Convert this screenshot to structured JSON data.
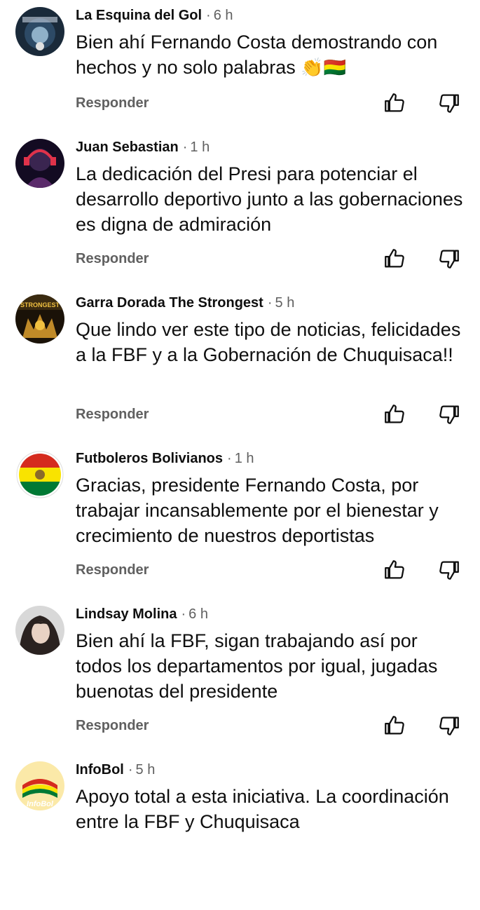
{
  "reply_label": "Responder",
  "separator": "·",
  "comments": [
    {
      "author": "La Esquina del Gol",
      "time": "6 h",
      "text": "Bien ahí Fernando Costa demostrando con hechos y no solo palabras",
      "emoji": "👏🇧🇴",
      "avatar": "la-esquina-del-gol-avatar"
    },
    {
      "author": "Juan Sebastian",
      "time": "1 h",
      "text": "La dedicación del Presi para potenciar el desarrollo deportivo junto a las gobernaciones es digna de admiración",
      "avatar": "juan-sebastian-avatar"
    },
    {
      "author": "Garra Dorada The Strongest",
      "time": "5 h",
      "text": "Que lindo ver este tipo de noticias, felicidades a la FBF y a la Gobernación de Chuquisaca!!",
      "avatar": "garra-dorada-avatar"
    },
    {
      "author": "Futboleros Bolivianos",
      "time": "1 h",
      "text": "Gracias, presidente Fernando Costa, por trabajar incansablemente por el bienestar y crecimiento de nuestros deportistas",
      "avatar": "futboleros-bolivianos-avatar"
    },
    {
      "author": "Lindsay Molina",
      "time": "6 h",
      "text": "Bien ahí la FBF, sigan trabajando así por todos los departamentos por igual, jugadas buenotas del presidente",
      "avatar": "lindsay-molina-avatar"
    },
    {
      "author": "InfoBol",
      "time": "5 h",
      "text": "Apoyo total a esta iniciativa. La coordinación entre la FBF y Chuquisaca",
      "avatar": "infobol-avatar",
      "avatar_label": "InfoBol"
    }
  ],
  "colors": {
    "text": "#0f0f0f",
    "secondary": "#606060",
    "background": "#ffffff"
  }
}
